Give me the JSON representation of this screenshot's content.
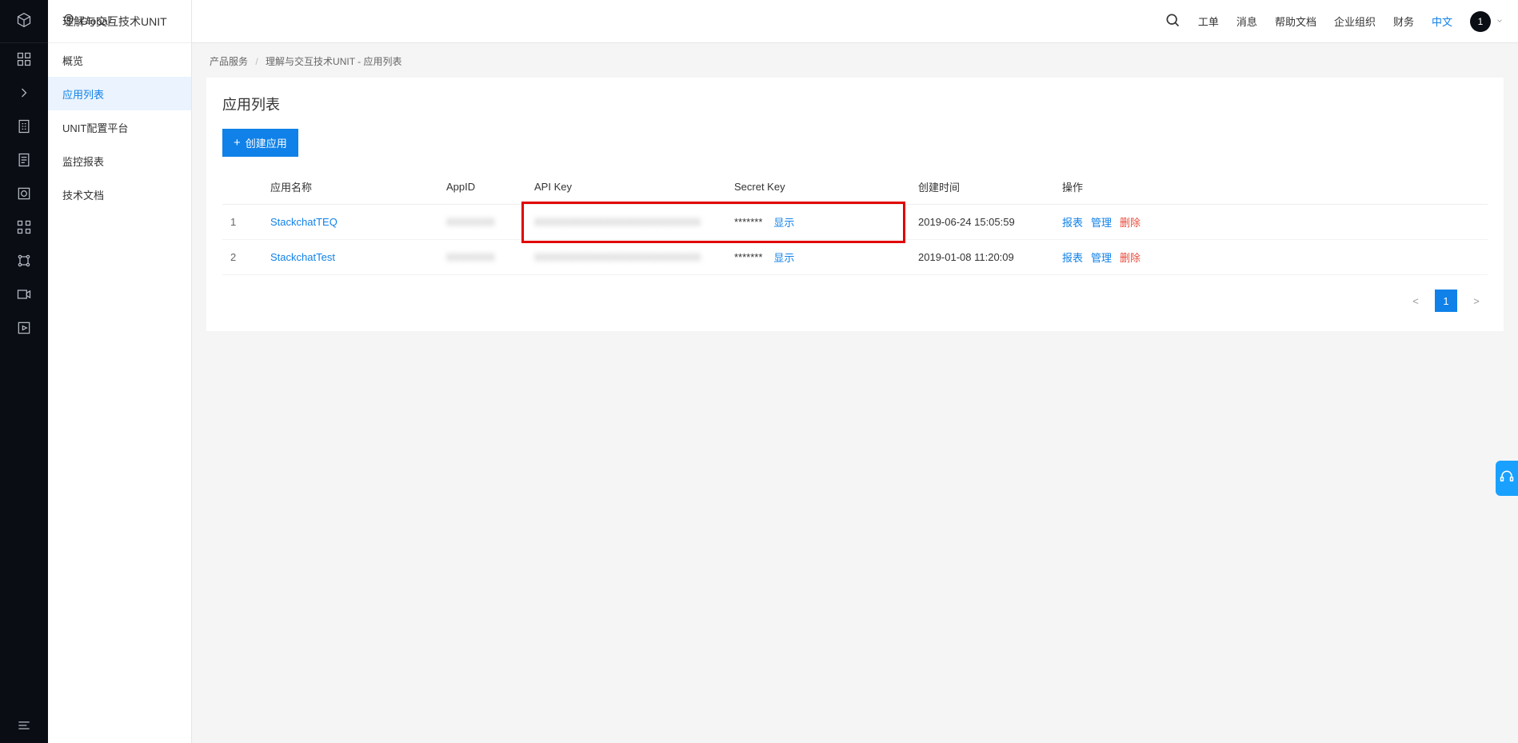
{
  "topbar": {
    "region": "Global",
    "links": {
      "tickets": "工单",
      "messages": "消息",
      "docs": "帮助文档",
      "org": "企业组织",
      "finance": "财务",
      "lang": "中文"
    },
    "avatar_initial": "1"
  },
  "sidebar": {
    "title": "理解与交互技术UNIT",
    "items": [
      {
        "label": "概览"
      },
      {
        "label": "应用列表"
      },
      {
        "label": "UNIT配置平台"
      },
      {
        "label": "监控报表"
      },
      {
        "label": "技术文档"
      }
    ],
    "active_index": 1
  },
  "breadcrumb": {
    "root": "产品服务",
    "sep": "/",
    "page": "理解与交互技术UNIT - 应用列表"
  },
  "panel": {
    "title": "应用列表",
    "create_btn": "创建应用",
    "columns": {
      "name": "应用名称",
      "appid": "AppID",
      "apikey": "API Key",
      "secret": "Secret Key",
      "created": "创建时间",
      "actions": "操作"
    },
    "secret_mask": "*******",
    "show_label": "显示",
    "action_labels": {
      "report": "报表",
      "manage": "管理",
      "delete": "删除"
    },
    "rows": [
      {
        "idx": "1",
        "name": "StackchatTEQ",
        "appid": "",
        "apikey": "",
        "created": "2019-06-24 15:05:59"
      },
      {
        "idx": "2",
        "name": "StackchatTest",
        "appid": "",
        "apikey": "",
        "created": "2019-01-08 11:20:09"
      }
    ],
    "pagination": {
      "prev": "<",
      "current": "1",
      "next": ">"
    }
  }
}
